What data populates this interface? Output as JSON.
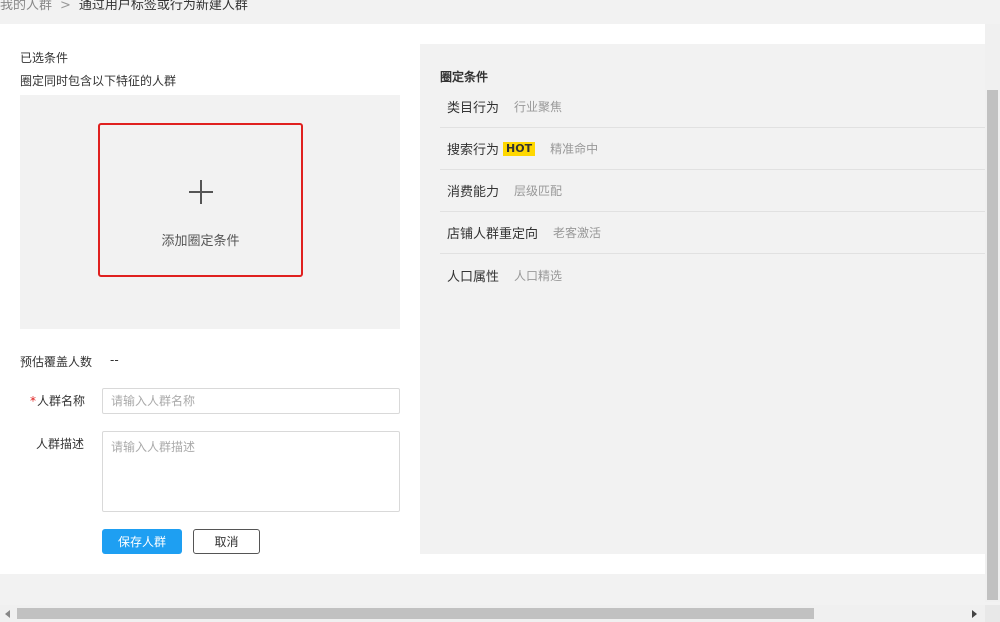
{
  "breadcrumb": {
    "parent": "我的人群",
    "separator": ">",
    "current": "通过用户标签或行为新建人群"
  },
  "selected": {
    "title": "已选条件",
    "subtitle": "圈定同时包含以下特征的人群",
    "add_label": "添加圈定条件",
    "add_icon": "plus-icon"
  },
  "estimate": {
    "label": "预估覆盖人数",
    "value": "--"
  },
  "form": {
    "name_required_mark": "*",
    "name_label": "人群名称",
    "name_placeholder": "请输入人群名称",
    "desc_label": "人群描述",
    "desc_placeholder": "请输入人群描述",
    "save_label": "保存人群",
    "cancel_label": "取消"
  },
  "conditions": {
    "title": "圈定条件",
    "items": [
      {
        "name": "类目行为",
        "desc": "行业聚焦"
      },
      {
        "name": "搜索行为",
        "badge": "HOT",
        "desc": "精准命中"
      },
      {
        "name": "消费能力",
        "desc": "层级匹配"
      },
      {
        "name": "店铺人群重定向",
        "desc": "老客激活"
      },
      {
        "name": "人口属性",
        "desc": "人口精选"
      }
    ]
  },
  "colors": {
    "accent": "#1e9ff2",
    "highlight_border": "#e0201f",
    "hot_badge": "#ffd800",
    "panel_bg": "#f2f2f2"
  }
}
